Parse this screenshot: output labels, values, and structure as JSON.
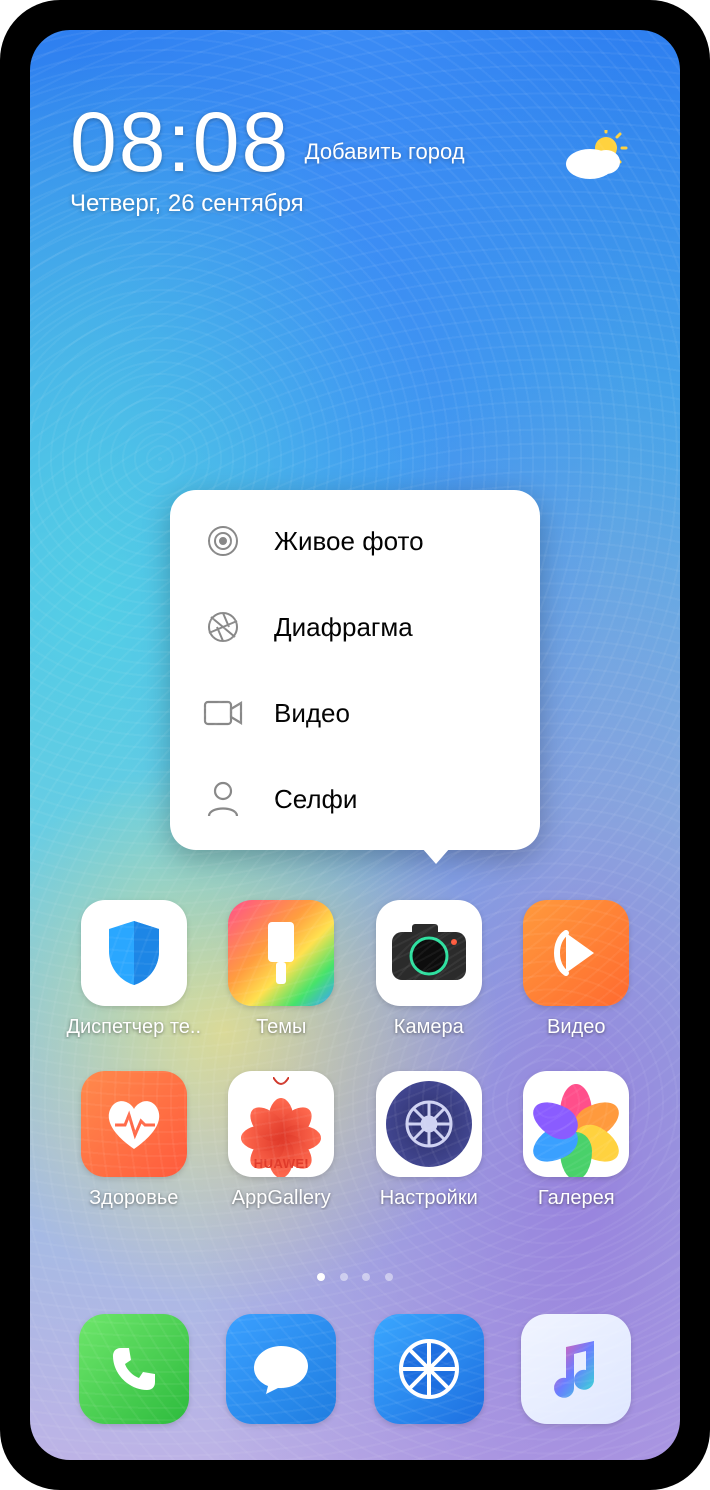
{
  "clock": {
    "time": "08:08",
    "add_city": "Добавить город",
    "date": "Четверг, 26 сентября"
  },
  "context_menu": {
    "items": [
      {
        "label": "Живое фото"
      },
      {
        "label": "Диафрагма"
      },
      {
        "label": "Видео"
      },
      {
        "label": "Селфи"
      }
    ]
  },
  "apps_row1": [
    {
      "label": "Диспетчер те.."
    },
    {
      "label": "Темы"
    },
    {
      "label": "Камера"
    },
    {
      "label": "Видео"
    }
  ],
  "apps_row2": [
    {
      "label": "Здоровье"
    },
    {
      "label": "AppGallery"
    },
    {
      "label": "Настройки"
    },
    {
      "label": "Галерея"
    }
  ],
  "appgallery_brand": "HUAWEI",
  "pages": {
    "count": 4,
    "active": 0
  }
}
